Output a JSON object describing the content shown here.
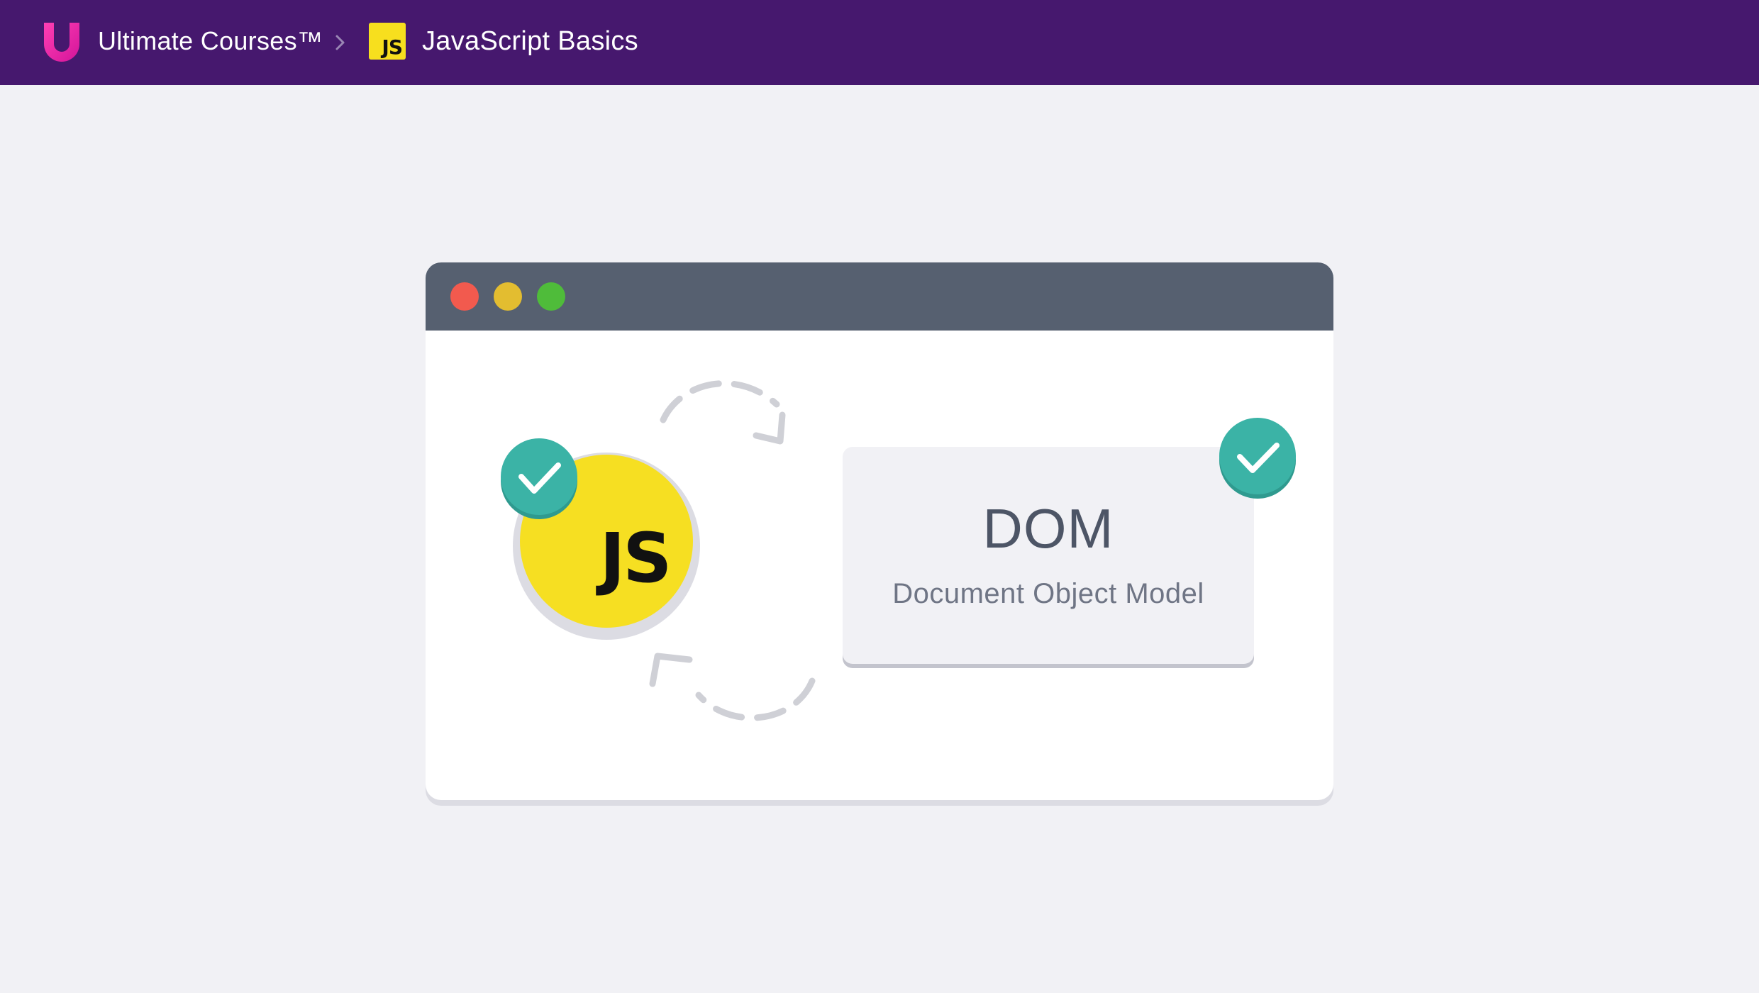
{
  "header": {
    "brand_name": "Ultimate Courses™",
    "brand_logo_icon": "ultimate-courses-u-logo",
    "separator_icon": "chevron-right-icon",
    "course_badge": "JS",
    "course_title": "JavaScript Basics"
  },
  "window": {
    "controls": [
      "close-dot",
      "minimize-dot",
      "maximize-dot"
    ],
    "js_label": "JS",
    "dom_title": "DOM",
    "dom_subtitle": "Document Object Model"
  },
  "colors": {
    "topbar": "#46186e",
    "page_bg": "#f1f1f5",
    "titlebar": "#566070",
    "js_yellow": "#f7df1e",
    "check_teal": "#3bb3a6",
    "dot_red": "#f25a4e",
    "dot_yellow": "#e3bd30",
    "dot_green": "#4fbc3a"
  }
}
